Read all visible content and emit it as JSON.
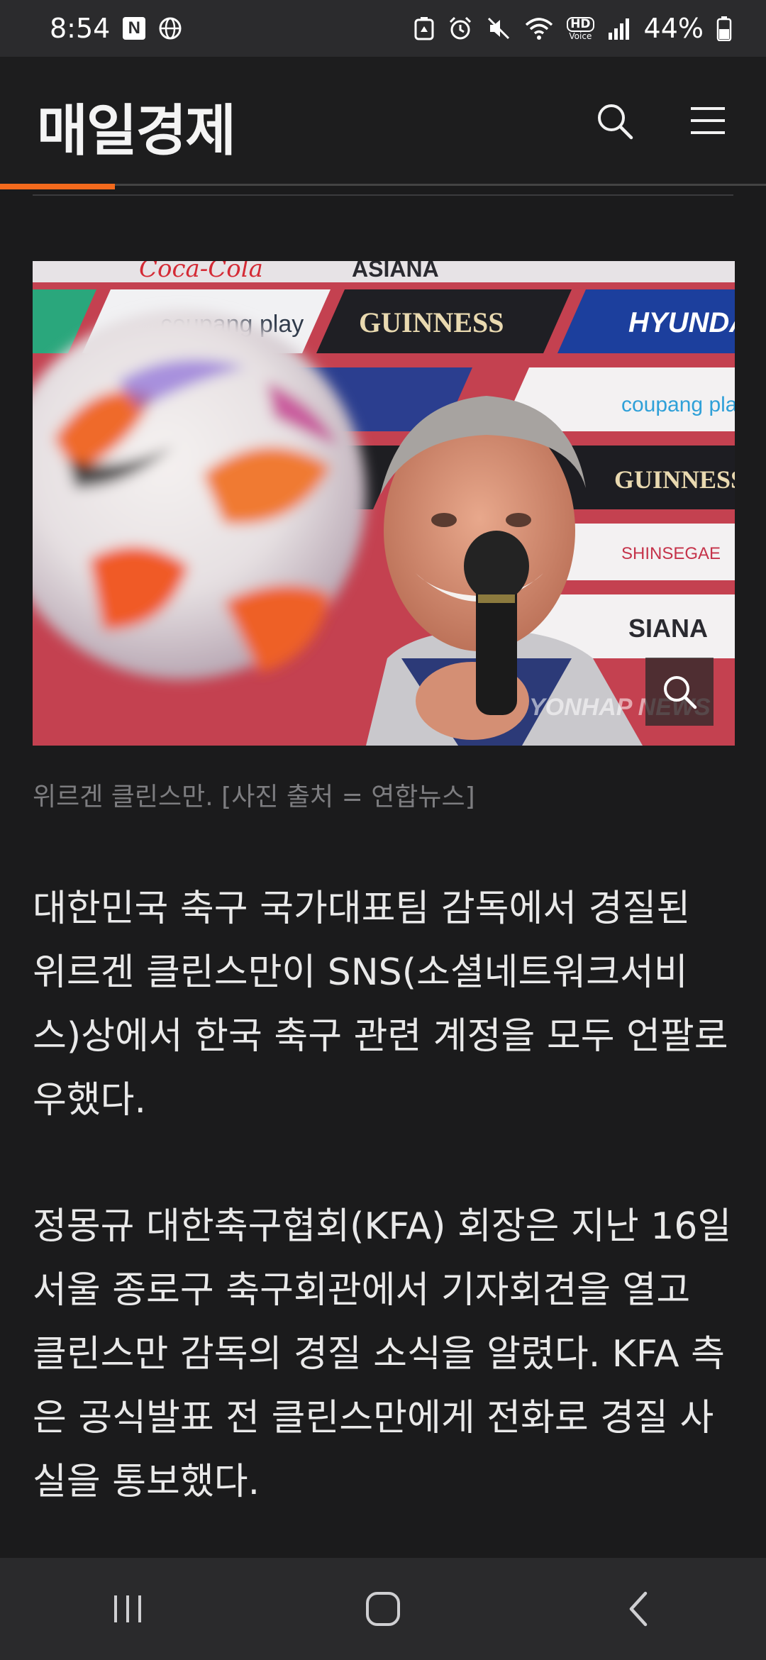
{
  "status_bar": {
    "time": "8:54",
    "battery": "44%",
    "notification_badge": "N",
    "hd_label": "HD",
    "voice_label": "Voice"
  },
  "header": {
    "logo": "매일경제",
    "accent_color": "#f36a1d"
  },
  "article": {
    "image": {
      "banner_texts": [
        "Coca-Cola",
        "ASIANA",
        "coupang play",
        "GUINNESS",
        "HYUNDAI",
        "coupang play",
        "GUINNESS",
        "SHINSEGAE",
        "SIANA"
      ],
      "watermark": "YONHAP NEWS"
    },
    "caption": "위르겐 클린스만. [사진 출처 = 연합뉴스]",
    "paragraphs": [
      "대한민국 축구 국가대표팀 감독에서 경질된 위르겐 클린스만이 SNS(소셜네트워크서비스)상에서 한국 축구 관련 계정을 모두 언팔로우했다.",
      "정몽규 대한축구협회(KFA) 회장은 지난 16일 서울 종로구 축구회관에서 기자회견을 열고 클린스만 감독의 경질 소식을 알렸다. KFA 측은 공식발표 전 클린스만에게 전화로 경질 사실을 통보했다."
    ]
  },
  "icons": {
    "search": "search-icon",
    "menu": "hamburger-menu-icon",
    "zoom": "zoom-icon",
    "recent_apps": "recent-apps-icon",
    "home": "home-icon",
    "back": "back-icon"
  }
}
